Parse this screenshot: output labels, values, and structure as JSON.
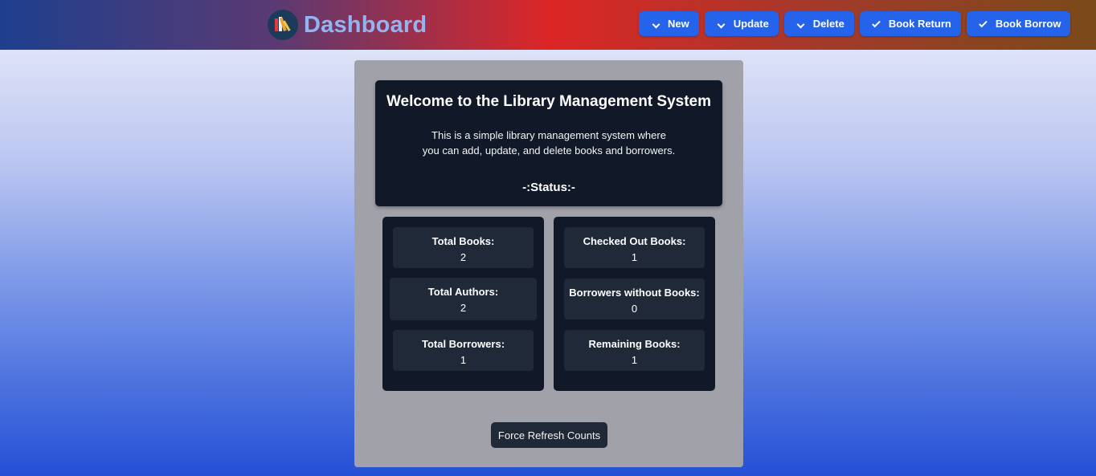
{
  "header": {
    "title": "Dashboard",
    "logo_icon": "books-icon",
    "buttons": [
      {
        "label": "New",
        "icon": "chevron-down-icon"
      },
      {
        "label": "Update",
        "icon": "chevron-down-icon"
      },
      {
        "label": "Delete",
        "icon": "chevron-down-icon"
      },
      {
        "label": "Book Return",
        "icon": "check-icon"
      },
      {
        "label": "Book Borrow",
        "icon": "check-icon"
      }
    ]
  },
  "welcome": {
    "heading": "Welcome to the Library Management System",
    "description_line1": "This is a simple library management system where",
    "description_line2": "you can add, update, and delete books and borrowers.",
    "status_label": "-:Status:-"
  },
  "stats": {
    "left": [
      {
        "label": "Total Books:",
        "value": "2"
      },
      {
        "label": "Total Authors:",
        "value": "2"
      },
      {
        "label": "Total Borrowers:",
        "value": "1"
      }
    ],
    "right": [
      {
        "label": "Checked Out Books:",
        "value": "1"
      },
      {
        "label": "Borrowers without Books:",
        "value": "0"
      },
      {
        "label": "Remaining Books:",
        "value": "1"
      }
    ]
  },
  "actions": {
    "refresh_label": "Force Refresh Counts"
  },
  "colors": {
    "accent": "#2563eb",
    "card_dark": "#111827",
    "stat_card": "#1f2937",
    "panel": "#a1a1aa"
  }
}
